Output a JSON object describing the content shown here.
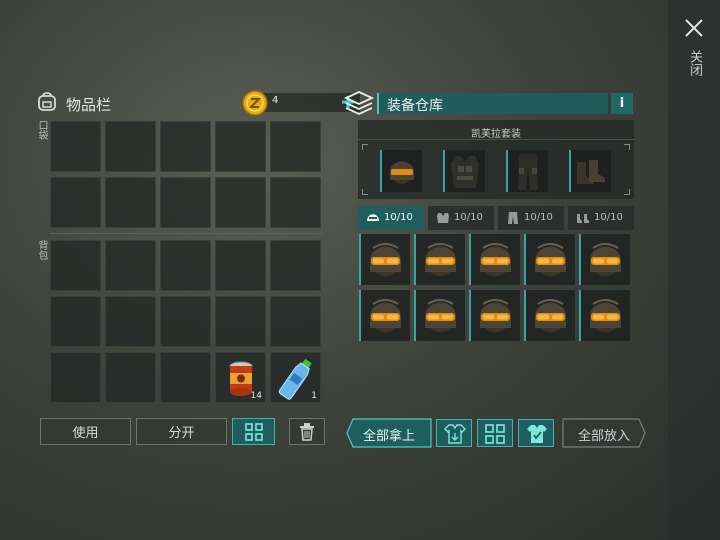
{
  "close": {
    "label": "关闭"
  },
  "inventory": {
    "title": "物品栏",
    "coins": "4",
    "pocket_label": "口袋",
    "bag_label": "背包",
    "items": [
      {
        "name": "canned-food",
        "qty": "14"
      },
      {
        "name": "water-bottle",
        "qty": "1"
      }
    ],
    "buttons": {
      "use": "使用",
      "split": "分开"
    }
  },
  "warehouse": {
    "title": "装备仓库",
    "info": "i",
    "set_name": "凯芙拉套装",
    "set_pieces": [
      "helmet",
      "vest",
      "pants",
      "boots"
    ],
    "tabs": [
      {
        "icon": "helmet-icon",
        "count": "10/10"
      },
      {
        "icon": "vest-icon",
        "count": "10/10"
      },
      {
        "icon": "pants-icon",
        "count": "10/10"
      },
      {
        "icon": "boots-icon",
        "count": "10/10"
      }
    ],
    "take_all": "全部拿上",
    "put_all": "全部放入"
  },
  "colors": {
    "accent": "#3fb3ad",
    "accent_dark": "#1e5e5c",
    "coin": "#e0a800"
  }
}
